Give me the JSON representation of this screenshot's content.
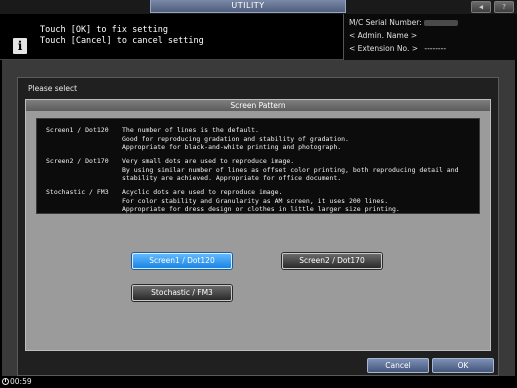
{
  "window": {
    "title": "UTILITY"
  },
  "titlebar": {
    "speaker_icon": "speaker-icon",
    "help_label": "?"
  },
  "info": {
    "line1": "Touch [OK] to fix setting",
    "line2": "Touch [Cancel] to cancel setting"
  },
  "serial": {
    "label": "M/C Serial Number:",
    "admin": "< Admin. Name >",
    "extension": "< Extension No. >",
    "extension_value": "--------"
  },
  "dialog": {
    "prompt": "Please select",
    "panel_title": "Screen Pattern",
    "descriptions": [
      {
        "label": "Screen1 / Dot120",
        "lines": [
          "The number of lines is the default.",
          "Good for reproducing gradation and stability of gradation.",
          "Appropriate for black-and-white printing and photograph."
        ]
      },
      {
        "label": "Screen2 / Dot170",
        "lines": [
          "Very small dots are used to reproduce image.",
          "By using similar number of lines as offset color printing, both reproducing detail and",
          "stability are achieved. Appropriate for office document."
        ]
      },
      {
        "label": "Stochastic / FM3",
        "lines": [
          "Acyclic dots are used to reproduce image.",
          "For color stability and Granularity as AM screen, it uses 200 lines.",
          "Appropriate for dress design or clothes in little larger size printing."
        ]
      }
    ],
    "options": {
      "screen1": "Screen1 / Dot120",
      "screen2": "Screen2 / Dot170",
      "stochastic": "Stochastic / FM3"
    },
    "selected": "Screen1 / Dot120",
    "cancel_label": "Cancel",
    "ok_label": "OK"
  },
  "status": {
    "timer": "00:59"
  },
  "colors": {
    "selected": "#2a96f0",
    "panel": "#9b9b9b",
    "footer_button": "#5b6d94"
  }
}
